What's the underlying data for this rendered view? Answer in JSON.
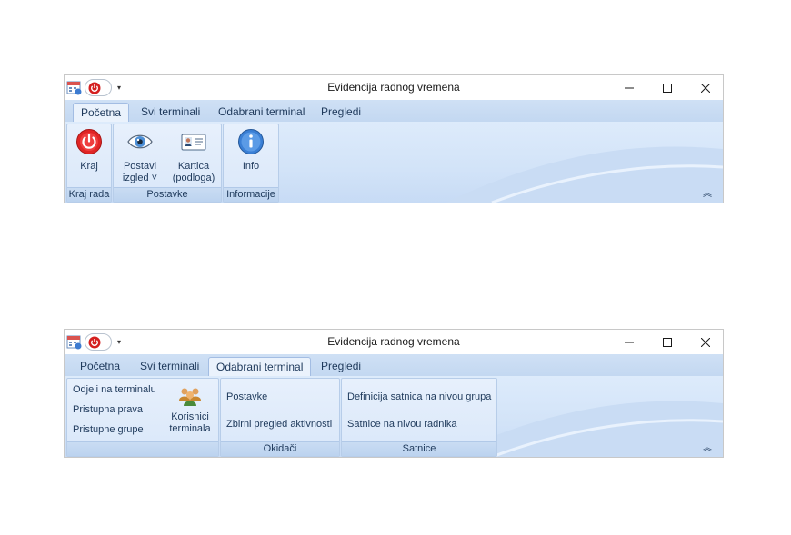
{
  "colors": {
    "accent": "#1e395b",
    "tab_bar": "#c9dcf3",
    "ribbon": "#dbe9fa"
  },
  "windows": [
    {
      "title": "Evidencija radnog vremena",
      "qat_dropdown": "▾",
      "tabs": [
        "Početna",
        "Svi terminali",
        "Odabrani terminal",
        "Pregledi"
      ],
      "active_tab": "Početna",
      "groups": [
        {
          "label": "Kraj rada",
          "buttons": [
            {
              "label": "Kraj",
              "icon": "power-icon"
            }
          ]
        },
        {
          "label": "Postavke",
          "buttons": [
            {
              "label_line1": "Postavi",
              "label_line2": "izgled ˅",
              "icon": "eye-icon"
            },
            {
              "label_line1": "Kartica",
              "label_line2": "(podloga)",
              "icon": "id-card-icon"
            }
          ]
        },
        {
          "label": "Informacije",
          "buttons": [
            {
              "label": "Info",
              "icon": "info-icon"
            }
          ]
        }
      ],
      "collapse": "︽"
    },
    {
      "title": "Evidencija radnog vremena",
      "qat_dropdown": "▾",
      "tabs": [
        "Početna",
        "Svi terminali",
        "Odabrani terminal",
        "Pregledi"
      ],
      "active_tab": "Odabrani terminal",
      "groups": [
        {
          "label": "",
          "items": [
            "Odjeli na terminalu",
            "Pristupna prava",
            "Pristupne grupe"
          ],
          "big_button": {
            "label_line1": "Korisnici",
            "label_line2": "terminala",
            "icon": "users-icon"
          }
        },
        {
          "label": "Okidači",
          "items": [
            "Postavke",
            "Zbirni pregled aktivnosti"
          ]
        },
        {
          "label": "Satnice",
          "items": [
            "Definicija satnica na nivou grupa",
            "Satnice na nivou radnika"
          ]
        }
      ],
      "collapse": "︽"
    }
  ]
}
